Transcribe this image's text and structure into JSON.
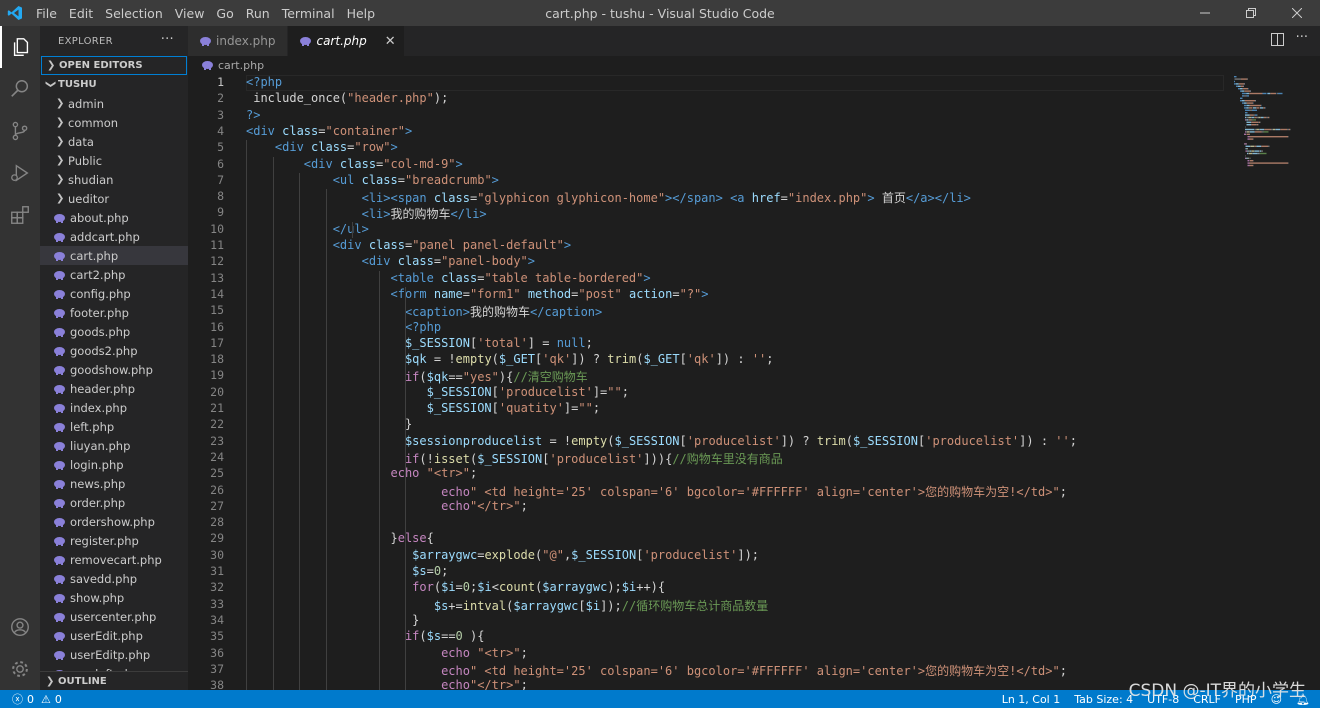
{
  "titlebar": {
    "menus": [
      "File",
      "Edit",
      "Selection",
      "View",
      "Go",
      "Run",
      "Terminal",
      "Help"
    ],
    "title": "cart.php - tushu - Visual Studio Code"
  },
  "sidebar": {
    "header": "EXPLORER",
    "open_editors": "OPEN EDITORS",
    "project": "TUSHU",
    "folders": [
      "admin",
      "common",
      "data",
      "Public",
      "shudian",
      "ueditor"
    ],
    "files": [
      "about.php",
      "addcart.php",
      "cart.php",
      "cart2.php",
      "config.php",
      "footer.php",
      "goods.php",
      "goods2.php",
      "goodshow.php",
      "header.php",
      "index.php",
      "left.php",
      "liuyan.php",
      "login.php",
      "news.php",
      "order.php",
      "ordershow.php",
      "register.php",
      "removecart.php",
      "savedd.php",
      "show.php",
      "usercenter.php",
      "userEdit.php",
      "userEditp.php",
      "userleft.php"
    ],
    "active_file": "cart.php",
    "outline": "OUTLINE"
  },
  "tabs": [
    {
      "label": "index.php",
      "active": false
    },
    {
      "label": "cart.php",
      "active": true
    }
  ],
  "breadcrumb": "cart.php",
  "editor": {
    "current_line": 1,
    "lines": [
      [
        [
          "tg",
          "<?php"
        ]
      ],
      [
        [
          "d",
          " include_once("
        ],
        [
          "st",
          "\"header.php\""
        ],
        [
          "d",
          ");"
        ]
      ],
      [
        [
          "tg",
          "?>"
        ]
      ],
      [
        [
          "tg",
          "<div "
        ],
        [
          "at",
          "class"
        ],
        [
          "d",
          "="
        ],
        [
          "st",
          "\"container\""
        ],
        [
          "tg",
          ">"
        ]
      ],
      [
        [
          "d",
          "    "
        ],
        [
          "tg",
          "<div "
        ],
        [
          "at",
          "class"
        ],
        [
          "d",
          "="
        ],
        [
          "st",
          "\"row\""
        ],
        [
          "tg",
          ">"
        ]
      ],
      [
        [
          "d",
          "        "
        ],
        [
          "tg",
          "<div "
        ],
        [
          "at",
          "class"
        ],
        [
          "d",
          "="
        ],
        [
          "st",
          "\"col-md-9\""
        ],
        [
          "tg",
          ">"
        ]
      ],
      [
        [
          "d",
          "            "
        ],
        [
          "tg",
          "<ul "
        ],
        [
          "at",
          "class"
        ],
        [
          "d",
          "="
        ],
        [
          "st",
          "\"breadcrumb\""
        ],
        [
          "tg",
          ">"
        ]
      ],
      [
        [
          "d",
          "                "
        ],
        [
          "tg",
          "<li><span "
        ],
        [
          "at",
          "class"
        ],
        [
          "d",
          "="
        ],
        [
          "st",
          "\"glyphicon glyphicon-home\""
        ],
        [
          "tg",
          "></span>"
        ],
        [
          "d",
          " "
        ],
        [
          "tg",
          "<a "
        ],
        [
          "at",
          "href"
        ],
        [
          "d",
          "="
        ],
        [
          "st",
          "\"index.php\""
        ],
        [
          "tg",
          ">"
        ],
        [
          "d",
          " 首页"
        ],
        [
          "tg",
          "</a></li>"
        ]
      ],
      [
        [
          "d",
          "                "
        ],
        [
          "tg",
          "<li>"
        ],
        [
          "d",
          "我的购物车"
        ],
        [
          "tg",
          "</li>"
        ]
      ],
      [
        [
          "d",
          "            "
        ],
        [
          "tg",
          "</ul>"
        ]
      ],
      [
        [
          "d",
          "            "
        ],
        [
          "tg",
          "<div "
        ],
        [
          "at",
          "class"
        ],
        [
          "d",
          "="
        ],
        [
          "st",
          "\"panel panel-default\""
        ],
        [
          "tg",
          ">"
        ]
      ],
      [
        [
          "d",
          "                "
        ],
        [
          "tg",
          "<div "
        ],
        [
          "at",
          "class"
        ],
        [
          "d",
          "="
        ],
        [
          "st",
          "\"panel-body\""
        ],
        [
          "tg",
          ">"
        ]
      ],
      [
        [
          "d",
          "                    "
        ],
        [
          "tg",
          "<table "
        ],
        [
          "at",
          "class"
        ],
        [
          "d",
          "="
        ],
        [
          "st",
          "\"table table-bordered\""
        ],
        [
          "tg",
          ">"
        ]
      ],
      [
        [
          "d",
          "                    "
        ],
        [
          "tg",
          "<form "
        ],
        [
          "at",
          "name"
        ],
        [
          "d",
          "="
        ],
        [
          "st",
          "\"form1\""
        ],
        [
          "d",
          " "
        ],
        [
          "at",
          "method"
        ],
        [
          "d",
          "="
        ],
        [
          "st",
          "\"post\""
        ],
        [
          "d",
          " "
        ],
        [
          "at",
          "action"
        ],
        [
          "d",
          "="
        ],
        [
          "st",
          "\"?\""
        ],
        [
          "tg",
          ">"
        ]
      ],
      [
        [
          "d",
          "                      "
        ],
        [
          "tg",
          "<caption>"
        ],
        [
          "d",
          "我的购物车"
        ],
        [
          "tg",
          "</caption>"
        ]
      ],
      [
        [
          "d",
          "                      "
        ],
        [
          "tg",
          "<?php"
        ]
      ],
      [
        [
          "d",
          "                      "
        ],
        [
          "vr",
          "$_SESSION"
        ],
        [
          "d",
          "["
        ],
        [
          "st",
          "'total'"
        ],
        [
          "d",
          "] = "
        ],
        [
          "tg",
          "null"
        ],
        [
          "d",
          ";"
        ]
      ],
      [
        [
          "d",
          "                      "
        ],
        [
          "vr",
          "$qk"
        ],
        [
          "d",
          " = !"
        ],
        [
          "fn",
          "empty"
        ],
        [
          "d",
          "("
        ],
        [
          "vr",
          "$_GET"
        ],
        [
          "d",
          "["
        ],
        [
          "st",
          "'qk'"
        ],
        [
          "d",
          "]) ? "
        ],
        [
          "fn",
          "trim"
        ],
        [
          "d",
          "("
        ],
        [
          "vr",
          "$_GET"
        ],
        [
          "d",
          "["
        ],
        [
          "st",
          "'qk'"
        ],
        [
          "d",
          "]) : "
        ],
        [
          "st",
          "''"
        ],
        [
          "d",
          ";"
        ]
      ],
      [
        [
          "d",
          "                      "
        ],
        [
          "kw",
          "if"
        ],
        [
          "d",
          "("
        ],
        [
          "vr",
          "$qk"
        ],
        [
          "d",
          "=="
        ],
        [
          "st",
          "\"yes\""
        ],
        [
          "d",
          "){"
        ],
        [
          "cm",
          "//清空购物车"
        ]
      ],
      [
        [
          "d",
          "                         "
        ],
        [
          "vr",
          "$_SESSION"
        ],
        [
          "d",
          "["
        ],
        [
          "st",
          "'producelist'"
        ],
        [
          "d",
          "]="
        ],
        [
          "st",
          "\"\""
        ],
        [
          "d",
          ";"
        ]
      ],
      [
        [
          "d",
          "                         "
        ],
        [
          "vr",
          "$_SESSION"
        ],
        [
          "d",
          "["
        ],
        [
          "st",
          "'quatity'"
        ],
        [
          "d",
          "]="
        ],
        [
          "st",
          "\"\""
        ],
        [
          "d",
          ";"
        ]
      ],
      [
        [
          "d",
          "                      }"
        ]
      ],
      [
        [
          "d",
          "                      "
        ],
        [
          "vr",
          "$sessionproducelist"
        ],
        [
          "d",
          " = !"
        ],
        [
          "fn",
          "empty"
        ],
        [
          "d",
          "("
        ],
        [
          "vr",
          "$_SESSION"
        ],
        [
          "d",
          "["
        ],
        [
          "st",
          "'producelist'"
        ],
        [
          "d",
          "]) ? "
        ],
        [
          "fn",
          "trim"
        ],
        [
          "d",
          "("
        ],
        [
          "vr",
          "$_SESSION"
        ],
        [
          "d",
          "["
        ],
        [
          "st",
          "'producelist'"
        ],
        [
          "d",
          "]) : "
        ],
        [
          "st",
          "''"
        ],
        [
          "d",
          ";"
        ]
      ],
      [
        [
          "d",
          "                      "
        ],
        [
          "kw",
          "if"
        ],
        [
          "d",
          "(!"
        ],
        [
          "fn",
          "isset"
        ],
        [
          "d",
          "("
        ],
        [
          "vr",
          "$_SESSION"
        ],
        [
          "d",
          "["
        ],
        [
          "st",
          "'producelist'"
        ],
        [
          "d",
          "])){"
        ],
        [
          "cm",
          "//购物车里没有商品"
        ]
      ],
      [
        [
          "d",
          "                    "
        ],
        [
          "kw",
          "echo"
        ],
        [
          "d",
          " "
        ],
        [
          "st",
          "\"<tr>\""
        ],
        [
          "d",
          ";"
        ]
      ],
      [
        [
          "d",
          "                           "
        ],
        [
          "kw",
          "echo"
        ],
        [
          "st",
          "\" <td height='25' colspan='6' bgcolor='#FFFFFF' align='center'>您的购物车为空!</td>\""
        ],
        [
          "d",
          ";"
        ]
      ],
      [
        [
          "d",
          "                           "
        ],
        [
          "kw",
          "echo"
        ],
        [
          "st",
          "\"</tr>\""
        ],
        [
          "d",
          ";"
        ]
      ],
      [
        [
          "d",
          ""
        ]
      ],
      [
        [
          "d",
          "                    }"
        ],
        [
          "kw",
          "else"
        ],
        [
          "d",
          "{"
        ]
      ],
      [
        [
          "d",
          "                       "
        ],
        [
          "vr",
          "$arraygwc"
        ],
        [
          "d",
          "="
        ],
        [
          "fn",
          "explode"
        ],
        [
          "d",
          "("
        ],
        [
          "st",
          "\"@\""
        ],
        [
          "d",
          ","
        ],
        [
          "vr",
          "$_SESSION"
        ],
        [
          "d",
          "["
        ],
        [
          "st",
          "'producelist'"
        ],
        [
          "d",
          "]);"
        ]
      ],
      [
        [
          "d",
          "                       "
        ],
        [
          "vr",
          "$s"
        ],
        [
          "d",
          "="
        ],
        [
          "nm",
          "0"
        ],
        [
          "d",
          ";"
        ]
      ],
      [
        [
          "d",
          "                       "
        ],
        [
          "kw",
          "for"
        ],
        [
          "d",
          "("
        ],
        [
          "vr",
          "$i"
        ],
        [
          "d",
          "="
        ],
        [
          "nm",
          "0"
        ],
        [
          "d",
          ";"
        ],
        [
          "vr",
          "$i"
        ],
        [
          "d",
          "<"
        ],
        [
          "fn",
          "count"
        ],
        [
          "d",
          "("
        ],
        [
          "vr",
          "$arraygwc"
        ],
        [
          "d",
          ");"
        ],
        [
          "vr",
          "$i"
        ],
        [
          "d",
          "++){"
        ]
      ],
      [
        [
          "d",
          "                          "
        ],
        [
          "vr",
          "$s"
        ],
        [
          "d",
          "+="
        ],
        [
          "fn",
          "intval"
        ],
        [
          "d",
          "("
        ],
        [
          "vr",
          "$arraygwc"
        ],
        [
          "d",
          "["
        ],
        [
          "vr",
          "$i"
        ],
        [
          "d",
          "]);"
        ],
        [
          "cm",
          "//循环购物车总计商品数量"
        ]
      ],
      [
        [
          "d",
          "                       }"
        ]
      ],
      [
        [
          "d",
          "                      "
        ],
        [
          "kw",
          "if"
        ],
        [
          "d",
          "("
        ],
        [
          "vr",
          "$s"
        ],
        [
          "d",
          "=="
        ],
        [
          "nm",
          "0"
        ],
        [
          "d",
          " ){"
        ]
      ],
      [
        [
          "d",
          "                           "
        ],
        [
          "kw",
          "echo"
        ],
        [
          "d",
          " "
        ],
        [
          "st",
          "\"<tr>\""
        ],
        [
          "d",
          ";"
        ]
      ],
      [
        [
          "d",
          "                           "
        ],
        [
          "kw",
          "echo"
        ],
        [
          "st",
          "\" <td height='25' colspan='6' bgcolor='#FFFFFF' align='center'>您的购物车为空!</td>\""
        ],
        [
          "d",
          ";"
        ]
      ],
      [
        [
          "d",
          "                           "
        ],
        [
          "kw",
          "echo"
        ],
        [
          "st",
          "\"</tr>\""
        ],
        [
          "d",
          ";"
        ]
      ]
    ]
  },
  "statusbar": {
    "errors": "0",
    "warnings": "0",
    "position": "Ln 1, Col 1",
    "tab_size": "Tab Size: 4",
    "encoding": "UTF-8",
    "eol": "CRLF",
    "language": "PHP"
  },
  "watermark": "CSDN @-IT界的小学生"
}
